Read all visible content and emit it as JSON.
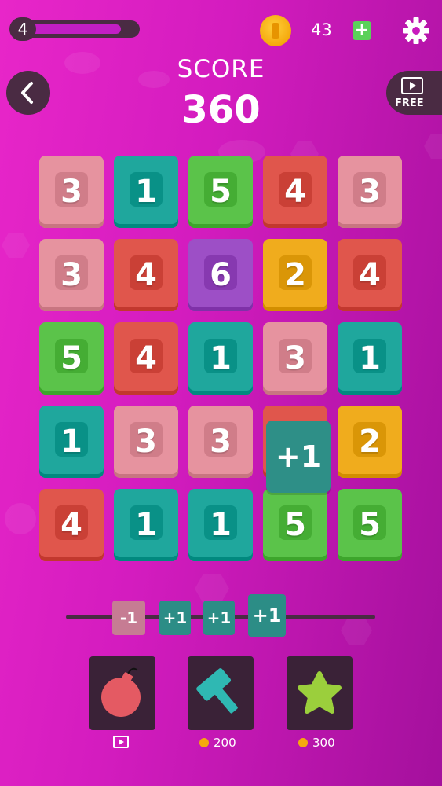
{
  "hud": {
    "level": "4",
    "level_progress": 0.85,
    "coins": "43",
    "add_coins_symbol": "+",
    "free_label": "FREE"
  },
  "score": {
    "label": "SCORE",
    "value": "360"
  },
  "colors": {
    "pink": "#e6939f",
    "teal": "#1fa79d",
    "green": "#5bc34a",
    "red": "#e0564c",
    "purple": "#9d4fc6",
    "yellow": "#f0ac1d",
    "dark_panel": "#4a2b43"
  },
  "board": {
    "rows": [
      [
        {
          "v": "3",
          "c": "pink"
        },
        {
          "v": "1",
          "c": "teal"
        },
        {
          "v": "5",
          "c": "green"
        },
        {
          "v": "4",
          "c": "red"
        },
        {
          "v": "3",
          "c": "pink"
        }
      ],
      [
        {
          "v": "3",
          "c": "pink"
        },
        {
          "v": "4",
          "c": "red"
        },
        {
          "v": "6",
          "c": "purple"
        },
        {
          "v": "2",
          "c": "yellow"
        },
        {
          "v": "4",
          "c": "red"
        }
      ],
      [
        {
          "v": "5",
          "c": "green"
        },
        {
          "v": "4",
          "c": "red"
        },
        {
          "v": "1",
          "c": "teal"
        },
        {
          "v": "3",
          "c": "pink"
        },
        {
          "v": "1",
          "c": "teal"
        }
      ],
      [
        {
          "v": "1",
          "c": "teal"
        },
        {
          "v": "3",
          "c": "pink"
        },
        {
          "v": "3",
          "c": "pink"
        },
        {
          "v": "",
          "c": "red"
        },
        {
          "v": "2",
          "c": "yellow"
        }
      ],
      [
        {
          "v": "4",
          "c": "red"
        },
        {
          "v": "1",
          "c": "teal"
        },
        {
          "v": "1",
          "c": "teal"
        },
        {
          "v": "5",
          "c": "green"
        },
        {
          "v": "5",
          "c": "green"
        }
      ]
    ],
    "held_tile": "+1"
  },
  "queue": [
    "-1",
    "+1",
    "+1",
    "+1"
  ],
  "powerups": [
    {
      "name": "bomb",
      "cost": ""
    },
    {
      "name": "hammer",
      "cost": "200"
    },
    {
      "name": "star",
      "cost": "300"
    }
  ]
}
